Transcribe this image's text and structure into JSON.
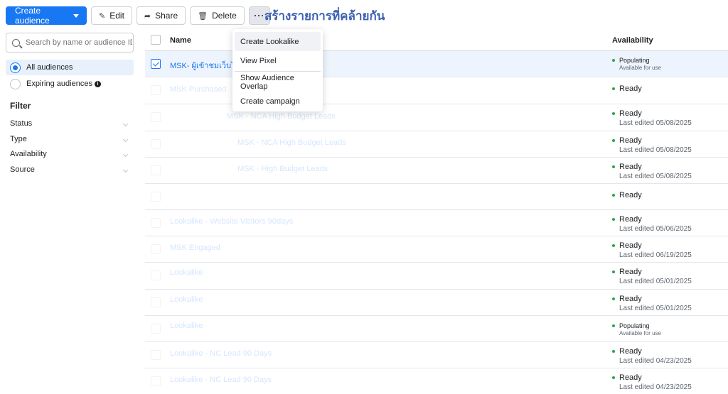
{
  "toolbar": {
    "create_label": "Create audience",
    "edit_label": "Edit",
    "share_label": "Share",
    "delete_label": "Delete",
    "more_label": "···"
  },
  "caption": "สร้างรายการที่คล้ายกัน",
  "sidebar": {
    "search_placeholder": "Search by name or audience ID",
    "views": [
      {
        "label": "All audiences",
        "selected": true
      },
      {
        "label": "Expiring audiences",
        "selected": false
      }
    ],
    "filter_title": "Filter",
    "filters": [
      "Status",
      "Type",
      "Availability",
      "Source"
    ]
  },
  "table": {
    "columns": {
      "name": "Name",
      "availability": "Availability"
    },
    "rows": [
      {
        "name": "MSK- ผู้เข้าชมเว็บไซต์",
        "status": "Populating",
        "sub": "Available for use"
      },
      {
        "name": "MSK Purchased",
        "status": "Ready",
        "sub": ""
      },
      {
        "name": "MSK - NCA High Budget Leads",
        "status": "Ready",
        "sub": "Last edited 05/08/2025"
      },
      {
        "name": "MSK - NCA High Budget Leads",
        "status": "Ready",
        "sub": "Last edited 05/08/2025"
      },
      {
        "name": "MSK - High Budget Leads",
        "status": "Ready",
        "sub": "Last edited 05/08/2025"
      },
      {
        "name": "",
        "status": "Ready",
        "sub": ""
      },
      {
        "name": "Lookalike - Website Visitors 90days",
        "status": "Ready",
        "sub": "Last edited 05/06/2025"
      },
      {
        "name": "MSK Engaged",
        "status": "Ready",
        "sub": "Last edited 06/19/2025"
      },
      {
        "name": "Lookalike",
        "status": "Ready",
        "sub": "Last edited 05/01/2025"
      },
      {
        "name": "Lookalike",
        "status": "Ready",
        "sub": "Last edited 05/01/2025"
      },
      {
        "name": "Lookalike",
        "status": "Populating",
        "sub": "Available for use"
      },
      {
        "name": "Lookalike - NC Lead 90 Days",
        "status": "Ready",
        "sub": "Last edited 04/23/2025"
      },
      {
        "name": "Lookalike - NC Lead 90 Days",
        "status": "Ready",
        "sub": "Last edited 04/23/2025"
      }
    ]
  },
  "menu": {
    "items": [
      "Create Lookalike",
      "View Pixel",
      "Show Audience Overlap",
      "Create campaign"
    ]
  },
  "colors": {
    "accent": "#1877f2",
    "ready_dot": "#31a24c",
    "caption": "#3b5fb0"
  }
}
